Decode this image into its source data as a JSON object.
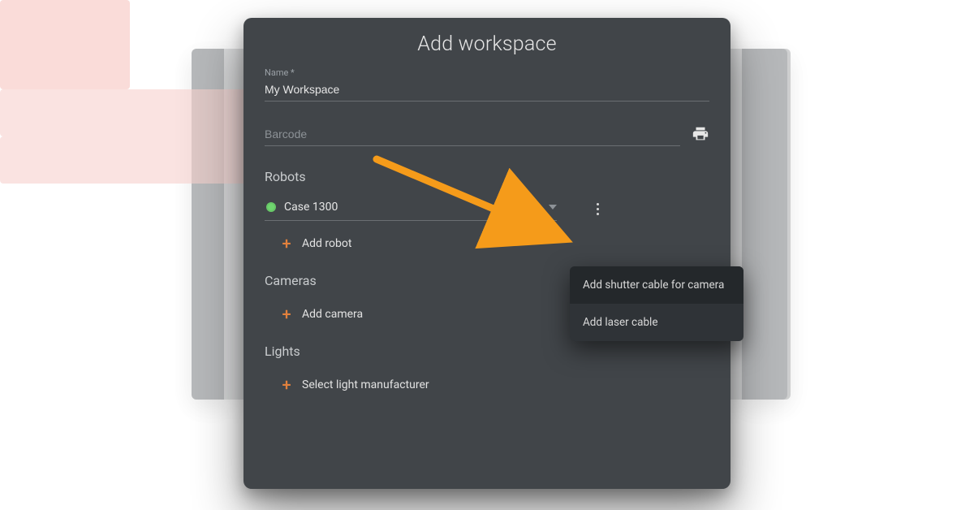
{
  "modal": {
    "title": "Add workspace",
    "name_label": "Name *",
    "name_value": "My Workspace",
    "barcode_placeholder": "Barcode",
    "barcode_value": ""
  },
  "robots": {
    "heading": "Robots",
    "selected": "Case 1300",
    "add_label": "Add robot"
  },
  "cameras": {
    "heading": "Cameras",
    "add_label": "Add camera"
  },
  "lights": {
    "heading": "Lights",
    "add_label": "Select light manufacturer"
  },
  "menu": {
    "item1": "Add shutter cable for camera",
    "item2": "Add laser cable"
  },
  "colors": {
    "accent": "#e2813d",
    "status_ok": "#6fd66f",
    "card_bg": "#414549",
    "menu_bg": "#2f3337",
    "arrow": "#f59b1a"
  }
}
